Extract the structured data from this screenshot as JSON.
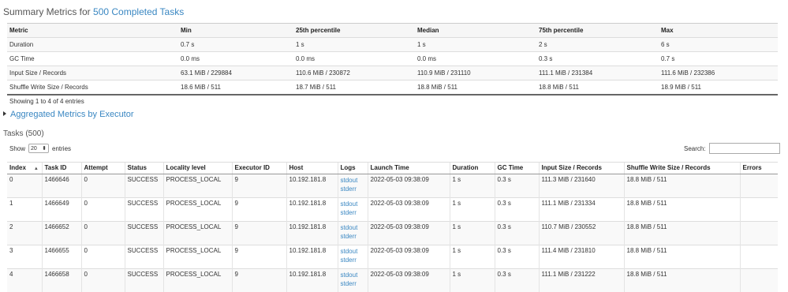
{
  "summary": {
    "title_prefix": "Summary Metrics for",
    "title_link": "500 Completed Tasks",
    "headers": [
      "Metric",
      "Min",
      "25th percentile",
      "Median",
      "75th percentile",
      "Max"
    ],
    "rows": [
      [
        "Duration",
        "0.7 s",
        "1 s",
        "1 s",
        "2 s",
        "6 s"
      ],
      [
        "GC Time",
        "0.0 ms",
        "0.0 ms",
        "0.0 ms",
        "0.3 s",
        "0.7 s"
      ],
      [
        "Input Size / Records",
        "63.1 MiB / 229884",
        "110.6 MiB / 230872",
        "110.9 MiB / 231110",
        "111.1 MiB / 231384",
        "111.6 MiB / 232386"
      ],
      [
        "Shuffle Write Size / Records",
        "18.6 MiB / 511",
        "18.7 MiB / 511",
        "18.8 MiB / 511",
        "18.8 MiB / 511",
        "18.9 MiB / 511"
      ]
    ],
    "showing": "Showing 1 to 4 of 4 entries"
  },
  "aggregated_link": "Aggregated Metrics by Executor",
  "tasks": {
    "title": "Tasks (500)",
    "show_label": "Show",
    "page_size": "20",
    "entries_label": "entries",
    "search_label": "Search:",
    "search_value": "",
    "headers": [
      "Index",
      "Task ID",
      "Attempt",
      "Status",
      "Locality level",
      "Executor ID",
      "Host",
      "Logs",
      "Launch Time",
      "Duration",
      "GC Time",
      "Input Size / Records",
      "Shuffle Write Size / Records",
      "Errors"
    ],
    "sort_indicator": "▲",
    "rows": [
      {
        "index": "0",
        "task_id": "1466646",
        "attempt": "0",
        "status": "SUCCESS",
        "locality": "PROCESS_LOCAL",
        "executor": "9",
        "host": "10.192.181.8",
        "stdout": "stdout",
        "stderr": "stderr",
        "launch": "2022-05-03 09:38:09",
        "duration": "1 s",
        "gc": "0.3 s",
        "input": "111.3 MiB / 231640",
        "shuffle": "18.8 MiB / 511",
        "errors": ""
      },
      {
        "index": "1",
        "task_id": "1466649",
        "attempt": "0",
        "status": "SUCCESS",
        "locality": "PROCESS_LOCAL",
        "executor": "9",
        "host": "10.192.181.8",
        "stdout": "stdout",
        "stderr": "stderr",
        "launch": "2022-05-03 09:38:09",
        "duration": "1 s",
        "gc": "0.3 s",
        "input": "111.1 MiB / 231334",
        "shuffle": "18.8 MiB / 511",
        "errors": ""
      },
      {
        "index": "2",
        "task_id": "1466652",
        "attempt": "0",
        "status": "SUCCESS",
        "locality": "PROCESS_LOCAL",
        "executor": "9",
        "host": "10.192.181.8",
        "stdout": "stdout",
        "stderr": "stderr",
        "launch": "2022-05-03 09:38:09",
        "duration": "1 s",
        "gc": "0.3 s",
        "input": "110.7 MiB / 230552",
        "shuffle": "18.8 MiB / 511",
        "errors": ""
      },
      {
        "index": "3",
        "task_id": "1466655",
        "attempt": "0",
        "status": "SUCCESS",
        "locality": "PROCESS_LOCAL",
        "executor": "9",
        "host": "10.192.181.8",
        "stdout": "stdout",
        "stderr": "stderr",
        "launch": "2022-05-03 09:38:09",
        "duration": "1 s",
        "gc": "0.3 s",
        "input": "111.4 MiB / 231810",
        "shuffle": "18.8 MiB / 511",
        "errors": ""
      },
      {
        "index": "4",
        "task_id": "1466658",
        "attempt": "0",
        "status": "SUCCESS",
        "locality": "PROCESS_LOCAL",
        "executor": "9",
        "host": "10.192.181.8",
        "stdout": "stdout",
        "stderr": "stderr",
        "launch": "2022-05-03 09:38:09",
        "duration": "1 s",
        "gc": "0.3 s",
        "input": "111.1 MiB / 231222",
        "shuffle": "18.8 MiB / 511",
        "errors": ""
      }
    ]
  }
}
